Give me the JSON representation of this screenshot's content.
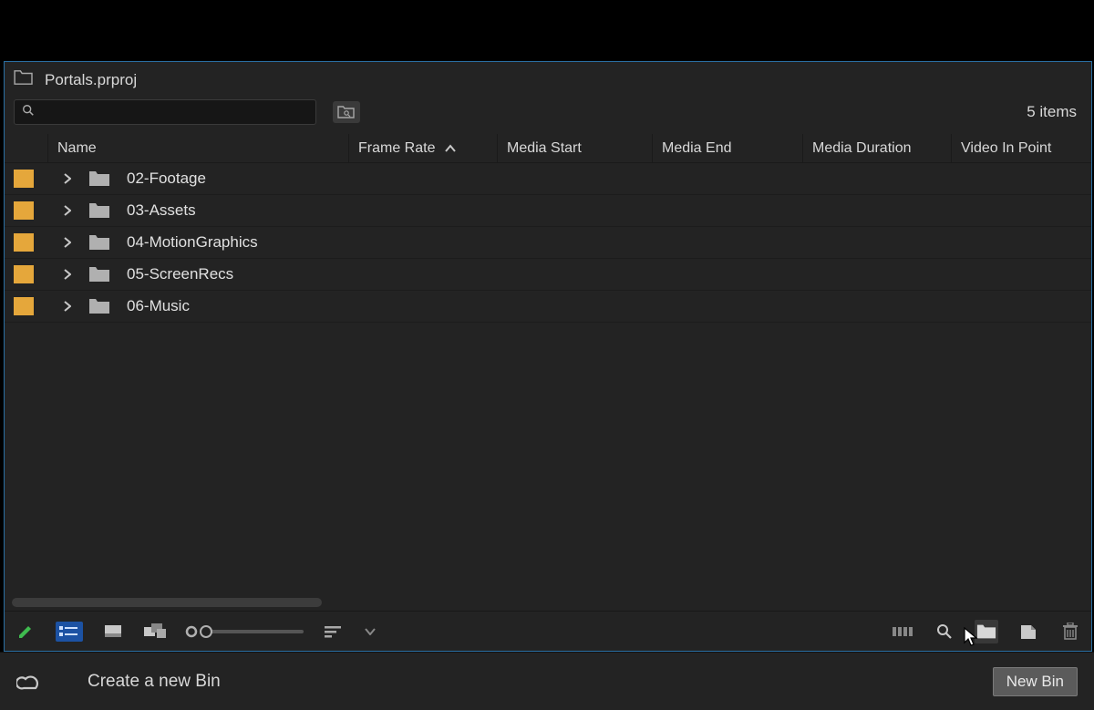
{
  "project": {
    "name": "Portals.prproj"
  },
  "search": {
    "placeholder": ""
  },
  "item_count": "5 items",
  "columns": {
    "name": "Name",
    "frame_rate": "Frame Rate",
    "media_start": "Media Start",
    "media_end": "Media End",
    "media_duration": "Media Duration",
    "video_in_point": "Video In Point"
  },
  "rows": [
    {
      "name": "02-Footage"
    },
    {
      "name": "03-Assets"
    },
    {
      "name": "04-MotionGraphics"
    },
    {
      "name": "05-ScreenRecs"
    },
    {
      "name": "06-Music"
    }
  ],
  "footer": {
    "tooltip": "Create a new Bin",
    "button_tooltip": "New Bin"
  }
}
